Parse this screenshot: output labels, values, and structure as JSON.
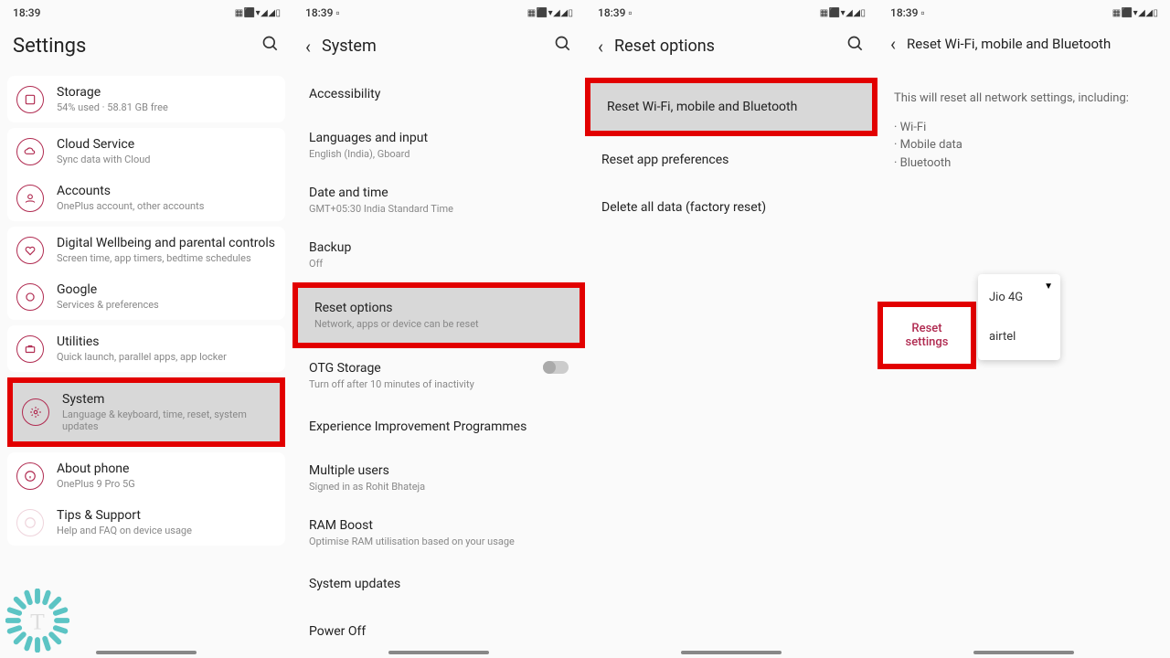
{
  "status": {
    "time": "18:39",
    "icons": "▦ ⬛ ▾ ◢ ◢ ▯"
  },
  "p1": {
    "title": "Settings",
    "items": [
      {
        "title": "Storage",
        "sub": "54% used · 58.81 GB free"
      },
      {
        "title": "Cloud Service",
        "sub": "Sync data with Cloud"
      },
      {
        "title": "Accounts",
        "sub": "OnePlus account, other accounts"
      },
      {
        "title": "Digital Wellbeing and parental controls",
        "sub": "Screen time, app timers, bedtime schedules"
      },
      {
        "title": "Google",
        "sub": "Services & preferences"
      },
      {
        "title": "Utilities",
        "sub": "Quick launch, parallel apps, app locker"
      },
      {
        "title": "System",
        "sub": "Language & keyboard, time, reset, system updates"
      },
      {
        "title": "About phone",
        "sub": "OnePlus 9 Pro 5G"
      },
      {
        "title": "Tips & Support",
        "sub": "Help and FAQ on device usage"
      }
    ]
  },
  "p2": {
    "title": "System",
    "items": [
      {
        "title": "Accessibility",
        "sub": ""
      },
      {
        "title": "Languages and input",
        "sub": "English (India), Gboard"
      },
      {
        "title": "Date and time",
        "sub": "GMT+05:30 India Standard Time"
      },
      {
        "title": "Backup",
        "sub": "Off"
      },
      {
        "title": "Reset options",
        "sub": "Network, apps or device can be reset"
      },
      {
        "title": "OTG Storage",
        "sub": "Turn off after 10 minutes of inactivity"
      },
      {
        "title": "Experience Improvement Programmes",
        "sub": ""
      },
      {
        "title": "Multiple users",
        "sub": "Signed in as Rohit Bhateja"
      },
      {
        "title": "RAM Boost",
        "sub": "Optimise RAM utilisation based on your usage"
      },
      {
        "title": "System updates",
        "sub": ""
      },
      {
        "title": "Power Off",
        "sub": ""
      }
    ]
  },
  "p3": {
    "title": "Reset options",
    "items": [
      "Reset Wi-Fi, mobile and Bluetooth",
      "Reset app preferences",
      "Delete all data (factory reset)"
    ]
  },
  "p4": {
    "title": "Reset Wi-Fi, mobile and Bluetooth",
    "desc": "This will reset all network settings, including:",
    "bullets": [
      "Wi-Fi",
      "Mobile data",
      "Bluetooth"
    ],
    "button": "Reset settings",
    "dropdown": [
      "Jio 4G",
      "airtel"
    ]
  }
}
